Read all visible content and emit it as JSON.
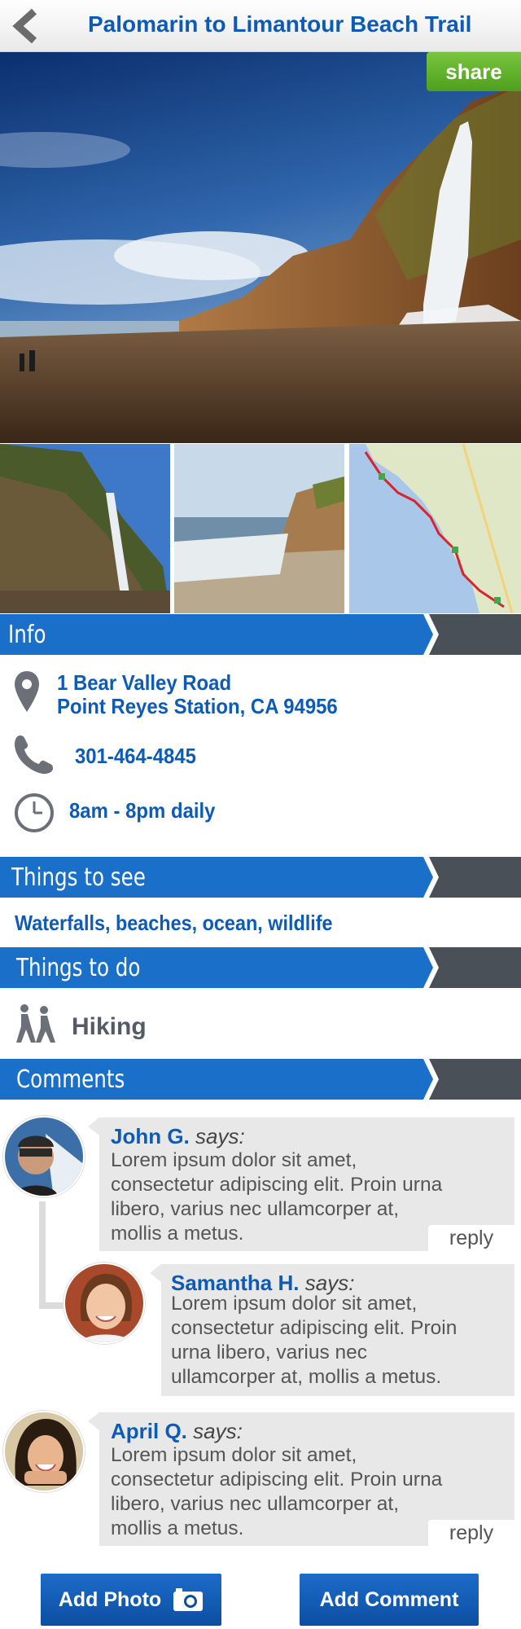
{
  "header": {
    "title": "Palomarin to Limantour Beach Trail",
    "back_icon": "chevron-left-icon"
  },
  "hero": {
    "share_label": "share"
  },
  "sections": {
    "info": "Info",
    "see": "Things to see",
    "do": "Things to do",
    "comments": "Comments"
  },
  "info": {
    "address_line1": "1 Bear Valley Road",
    "address_line2": "Point Reyes Station, CA 94956",
    "phone": "301-464-4845",
    "hours": "8am - 8pm daily"
  },
  "see": {
    "text": "Waterfalls, beaches, ocean, wildlife"
  },
  "do": {
    "activity": "Hiking"
  },
  "comments": [
    {
      "name": "John G.",
      "says": "says:",
      "lines": [
        "Lorem ipsum dolor sit amet,",
        "consectetur adipiscing elit. Proin urna",
        "libero, varius nec ullamcorper at,",
        "mollis a metus."
      ],
      "reply": "reply"
    },
    {
      "name": "Samantha H.",
      "says": "says:",
      "lines": [
        "Lorem ipsum dolor sit amet,",
        "consectetur adipiscing elit. Proin",
        "urna libero, varius nec",
        "ullamcorper at, mollis a metus."
      ]
    },
    {
      "name": "April Q.",
      "says": "says:",
      "lines": [
        "Lorem ipsum dolor sit amet,",
        "consectetur adipiscing elit. Proin urna",
        "libero, varius nec ullamcorper at,",
        "mollis a metus."
      ],
      "reply": "reply"
    }
  ],
  "buttons": {
    "add_photo": "Add Photo",
    "add_comment": "Add Comment"
  },
  "colors": {
    "accent": "#0d5bb5",
    "bar_blue": "#1a6fc8",
    "bar_grey": "#4a5058",
    "share_green": "#5fae2a"
  }
}
